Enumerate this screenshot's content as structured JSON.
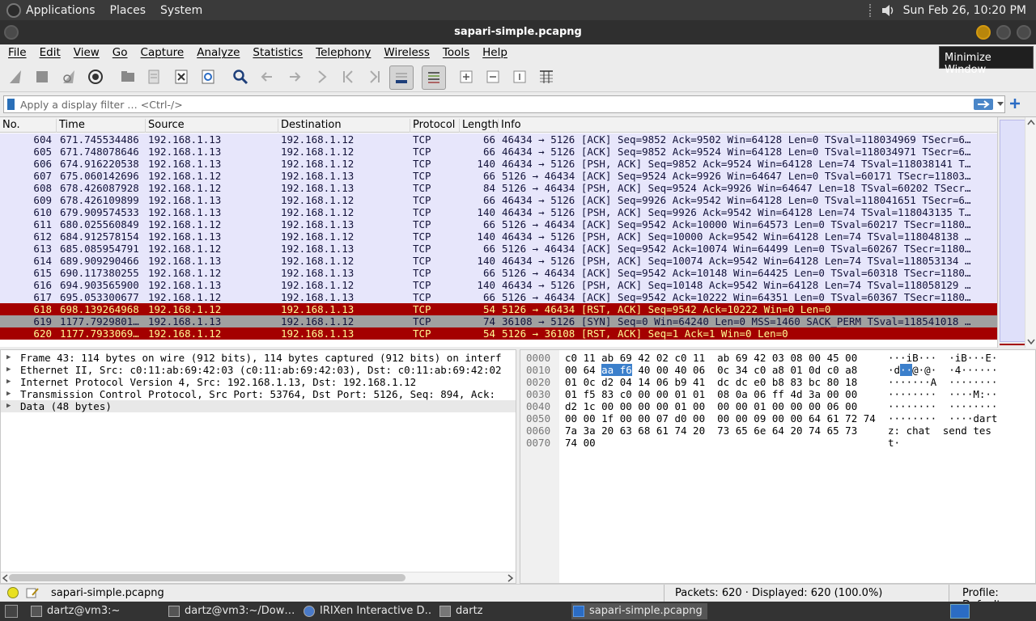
{
  "topbar": {
    "menus": [
      "Applications",
      "Places",
      "System"
    ],
    "clock": "Sun Feb 26, 10:20 PM"
  },
  "window": {
    "title": "sapari-simple.pcapng"
  },
  "menubar": [
    "File",
    "Edit",
    "View",
    "Go",
    "Capture",
    "Analyze",
    "Statistics",
    "Telephony",
    "Wireless",
    "Tools",
    "Help"
  ],
  "tooltip": "Minimize Window",
  "toolbar": {
    "icons": [
      "shark-fin-start-icon",
      "stop-square-icon",
      "shark-fin-restart-icon",
      "gear-options-icon",
      "folder-open-icon",
      "file-save-icon",
      "close-file-icon",
      "reload-icon",
      "find-magnifier-icon",
      "go-back-icon",
      "go-forward-icon",
      "go-to-packet-icon",
      "go-first-icon",
      "go-last-icon",
      "autoscroll-icon",
      "colorize-icon",
      "zoom-in-icon",
      "zoom-out-icon",
      "normal-size-icon",
      "resize-columns-icon"
    ]
  },
  "filter": {
    "placeholder": "Apply a display filter … <Ctrl-/>"
  },
  "packet_list": {
    "columns": [
      "No.",
      "Time",
      "Source",
      "Destination",
      "Protocol",
      "Length",
      "Info"
    ],
    "rows": [
      {
        "no": "604",
        "time": "671.745534486",
        "src": "192.168.1.13",
        "dst": "192.168.1.12",
        "proto": "TCP",
        "len": "66",
        "info": "46434 → 5126 [ACK] Seq=9852 Ack=9502 Win=64128 Len=0 TSval=118034969 TSecr=6…",
        "style": "normal"
      },
      {
        "no": "605",
        "time": "671.748078646",
        "src": "192.168.1.13",
        "dst": "192.168.1.12",
        "proto": "TCP",
        "len": "66",
        "info": "46434 → 5126 [ACK] Seq=9852 Ack=9524 Win=64128 Len=0 TSval=118034971 TSecr=6…",
        "style": "normal"
      },
      {
        "no": "606",
        "time": "674.916220538",
        "src": "192.168.1.13",
        "dst": "192.168.1.12",
        "proto": "TCP",
        "len": "140",
        "info": "46434 → 5126 [PSH, ACK] Seq=9852 Ack=9524 Win=64128 Len=74 TSval=118038141 T…",
        "style": "normal"
      },
      {
        "no": "607",
        "time": "675.060142696",
        "src": "192.168.1.12",
        "dst": "192.168.1.13",
        "proto": "TCP",
        "len": "66",
        "info": "5126 → 46434 [ACK] Seq=9524 Ack=9926 Win=64647 Len=0 TSval=60171 TSecr=11803…",
        "style": "normal"
      },
      {
        "no": "608",
        "time": "678.426087928",
        "src": "192.168.1.12",
        "dst": "192.168.1.13",
        "proto": "TCP",
        "len": "84",
        "info": "5126 → 46434 [PSH, ACK] Seq=9524 Ack=9926 Win=64647 Len=18 TSval=60202 TSecr…",
        "style": "normal"
      },
      {
        "no": "609",
        "time": "678.426109899",
        "src": "192.168.1.13",
        "dst": "192.168.1.12",
        "proto": "TCP",
        "len": "66",
        "info": "46434 → 5126 [ACK] Seq=9926 Ack=9542 Win=64128 Len=0 TSval=118041651 TSecr=6…",
        "style": "normal"
      },
      {
        "no": "610",
        "time": "679.909574533",
        "src": "192.168.1.13",
        "dst": "192.168.1.12",
        "proto": "TCP",
        "len": "140",
        "info": "46434 → 5126 [PSH, ACK] Seq=9926 Ack=9542 Win=64128 Len=74 TSval=118043135 T…",
        "style": "normal"
      },
      {
        "no": "611",
        "time": "680.025560849",
        "src": "192.168.1.12",
        "dst": "192.168.1.13",
        "proto": "TCP",
        "len": "66",
        "info": "5126 → 46434 [ACK] Seq=9542 Ack=10000 Win=64573 Len=0 TSval=60217 TSecr=1180…",
        "style": "normal"
      },
      {
        "no": "612",
        "time": "684.912578154",
        "src": "192.168.1.13",
        "dst": "192.168.1.12",
        "proto": "TCP",
        "len": "140",
        "info": "46434 → 5126 [PSH, ACK] Seq=10000 Ack=9542 Win=64128 Len=74 TSval=118048138 …",
        "style": "normal"
      },
      {
        "no": "613",
        "time": "685.085954791",
        "src": "192.168.1.12",
        "dst": "192.168.1.13",
        "proto": "TCP",
        "len": "66",
        "info": "5126 → 46434 [ACK] Seq=9542 Ack=10074 Win=64499 Len=0 TSval=60267 TSecr=1180…",
        "style": "normal"
      },
      {
        "no": "614",
        "time": "689.909290466",
        "src": "192.168.1.13",
        "dst": "192.168.1.12",
        "proto": "TCP",
        "len": "140",
        "info": "46434 → 5126 [PSH, ACK] Seq=10074 Ack=9542 Win=64128 Len=74 TSval=118053134 …",
        "style": "normal"
      },
      {
        "no": "615",
        "time": "690.117380255",
        "src": "192.168.1.12",
        "dst": "192.168.1.13",
        "proto": "TCP",
        "len": "66",
        "info": "5126 → 46434 [ACK] Seq=9542 Ack=10148 Win=64425 Len=0 TSval=60318 TSecr=1180…",
        "style": "normal"
      },
      {
        "no": "616",
        "time": "694.903565900",
        "src": "192.168.1.13",
        "dst": "192.168.1.12",
        "proto": "TCP",
        "len": "140",
        "info": "46434 → 5126 [PSH, ACK] Seq=10148 Ack=9542 Win=64128 Len=74 TSval=118058129 …",
        "style": "normal"
      },
      {
        "no": "617",
        "time": "695.053300677",
        "src": "192.168.1.12",
        "dst": "192.168.1.13",
        "proto": "TCP",
        "len": "66",
        "info": "5126 → 46434 [ACK] Seq=9542 Ack=10222 Win=64351 Len=0 TSval=60367 TSecr=1180…",
        "style": "normal"
      },
      {
        "no": "618",
        "time": "698.139264968",
        "src": "192.168.1.12",
        "dst": "192.168.1.13",
        "proto": "TCP",
        "len": "54",
        "info": "5126 → 46434 [RST, ACK] Seq=9542 Ack=10222 Win=0 Len=0",
        "style": "rst"
      },
      {
        "no": "619",
        "time": "1177.7929801…",
        "src": "192.168.1.13",
        "dst": "192.168.1.12",
        "proto": "TCP",
        "len": "74",
        "info": "36108 → 5126 [SYN] Seq=0 Win=64240 Len=0 MSS=1460 SACK_PERM TSval=118541018 …",
        "style": "syn"
      },
      {
        "no": "620",
        "time": "1177.7933069…",
        "src": "192.168.1.12",
        "dst": "192.168.1.13",
        "proto": "TCP",
        "len": "54",
        "info": "5126 → 36108 [RST, ACK] Seq=1 Ack=1 Win=0 Len=0",
        "style": "rst"
      }
    ]
  },
  "details": [
    "Frame 43: 114 bytes on wire (912 bits), 114 bytes captured (912 bits) on interf",
    "Ethernet II, Src: c0:11:ab:69:42:03 (c0:11:ab:69:42:03), Dst: c0:11:ab:69:42:02",
    "Internet Protocol Version 4, Src: 192.168.1.13, Dst: 192.168.1.12",
    "Transmission Control Protocol, Src Port: 53764, Dst Port: 5126, Seq: 894, Ack:",
    "Data (48 bytes)"
  ],
  "bytes": [
    {
      "off": "0000",
      "hex": "c0 11 ab 69 42 02 c0 11  ab 69 42 03 08 00 45 00",
      "asc": "···iB···  ·iB···E·"
    },
    {
      "off": "0010",
      "hex_pre": "00 64 ",
      "hex_sel": "aa f6",
      "hex_post": " 40 00 40 06  0c 34 c0 a8 01 0d c0 a8",
      "asc_pre": "·d",
      "asc_sel": "··",
      "asc_post": "@·@·  ·4······"
    },
    {
      "off": "0020",
      "hex": "01 0c d2 04 14 06 b9 41  dc dc e0 b8 83 bc 80 18",
      "asc": "·······A  ········"
    },
    {
      "off": "0030",
      "hex": "01 f5 83 c0 00 00 01 01  08 0a 06 ff 4d 3a 00 00",
      "asc": "········  ····M:··"
    },
    {
      "off": "0040",
      "hex": "d2 1c 00 00 00 00 01 00  00 00 01 00 00 00 06 00",
      "asc": "········  ········"
    },
    {
      "off": "0050",
      "hex": "00 00 1f 00 00 07 d0 00  00 00 09 00 00 64 61 72 74",
      "asc": "········  ····dart"
    },
    {
      "off": "0060",
      "hex": "7a 3a 20 63 68 61 74 20  73 65 6e 64 20 74 65 73",
      "asc": "z: chat  send tes"
    },
    {
      "off": "0070",
      "hex": "74 00",
      "asc": "t·"
    }
  ],
  "status": {
    "file": "sapari-simple.pcapng",
    "packets": "Packets: 620 · Displayed: 620 (100.0%)",
    "profile": "Profile: Default"
  },
  "taskbar": [
    {
      "label": "dartz@vm3:~",
      "active": false
    },
    {
      "label": "dartz@vm3:~/Dow…",
      "active": false
    },
    {
      "label": "IRIXen Interactive D…",
      "active": false
    },
    {
      "label": "dartz",
      "active": false
    },
    {
      "label": "sapari-simple.pcapng",
      "active": true
    }
  ],
  "colors": {
    "rst_bg": "#a40000",
    "rst_fg": "#fffb95",
    "normal_bg": "#e7e6fb",
    "syn_bg": "#a0a0a0",
    "selection": "#3b7fcb"
  }
}
